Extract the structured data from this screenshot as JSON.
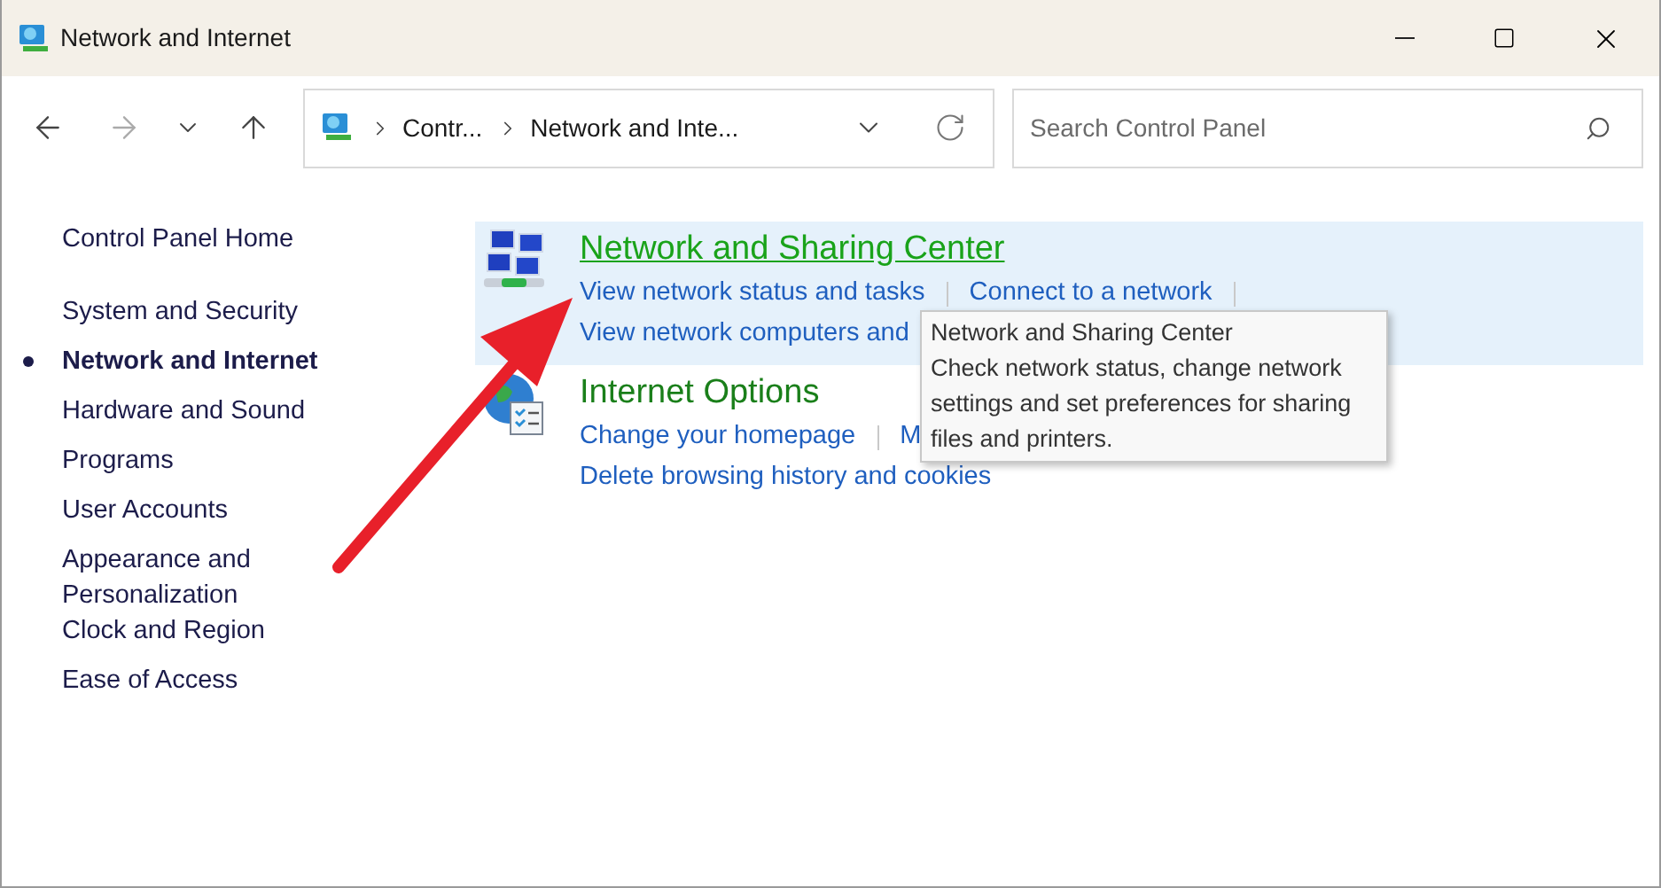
{
  "window": {
    "title": "Network and Internet"
  },
  "address_bar": {
    "crumbs": [
      "Contr...",
      "Network and Inte..."
    ]
  },
  "search": {
    "placeholder": "Search Control Panel"
  },
  "sidebar": {
    "home": "Control Panel Home",
    "items": [
      {
        "label": "System and Security",
        "selected": false
      },
      {
        "label": "Network and Internet",
        "selected": true
      },
      {
        "label": "Hardware and Sound",
        "selected": false
      },
      {
        "label": "Programs",
        "selected": false
      },
      {
        "label": "User Accounts",
        "selected": false
      },
      {
        "label": "Appearance and Personalization",
        "selected": false
      },
      {
        "label": "Clock and Region",
        "selected": false
      },
      {
        "label": "Ease of Access",
        "selected": false
      }
    ]
  },
  "categories": [
    {
      "title": "Network and Sharing Center",
      "kind": "network",
      "highlighted": true,
      "rows": [
        {
          "links": [
            "View network status and tasks",
            "Connect to a network"
          ],
          "trailing_separator": true
        },
        {
          "links": [
            "View network computers and"
          ],
          "trailing_separator": false
        }
      ]
    },
    {
      "title": "Internet Options",
      "kind": "globe",
      "highlighted": false,
      "rows": [
        {
          "links": [
            "Change your homepage",
            "M"
          ],
          "trailing_separator": false
        },
        {
          "links": [
            "Delete browsing history and cookies"
          ],
          "trailing_separator": false
        }
      ]
    }
  ],
  "tooltip": {
    "title": "Network and Sharing Center",
    "text": "Check network status, change network settings and set preferences for sharing files and printers."
  }
}
